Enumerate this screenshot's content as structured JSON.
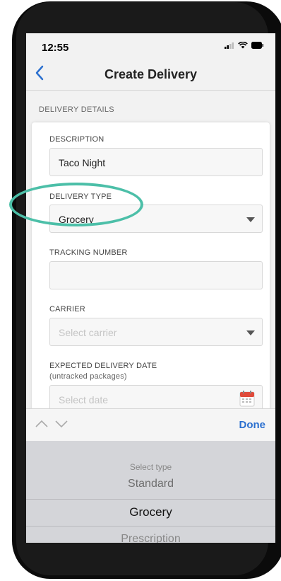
{
  "status": {
    "time": "12:55"
  },
  "nav": {
    "title": "Create Delivery"
  },
  "section": {
    "label": "DELIVERY DETAILS"
  },
  "form": {
    "description": {
      "label": "DESCRIPTION",
      "value": "Taco Night"
    },
    "delivery_type": {
      "label": "DELIVERY TYPE",
      "value": "Grocery"
    },
    "tracking": {
      "label": "TRACKING NUMBER",
      "value": ""
    },
    "carrier": {
      "label": "CARRIER",
      "placeholder": "Select carrier"
    },
    "date": {
      "label": "EXPECTED DELIVERY DATE",
      "sublabel": "(untracked packages)",
      "placeholder": "Select date"
    }
  },
  "accessory": {
    "done_label": "Done"
  },
  "picker": {
    "title": "Select type",
    "options": [
      "Standard",
      "Grocery",
      "Prescription"
    ],
    "selected": "Grocery"
  },
  "colors": {
    "accent": "#2a6fcf",
    "highlight_ring": "#4cbfa8"
  }
}
